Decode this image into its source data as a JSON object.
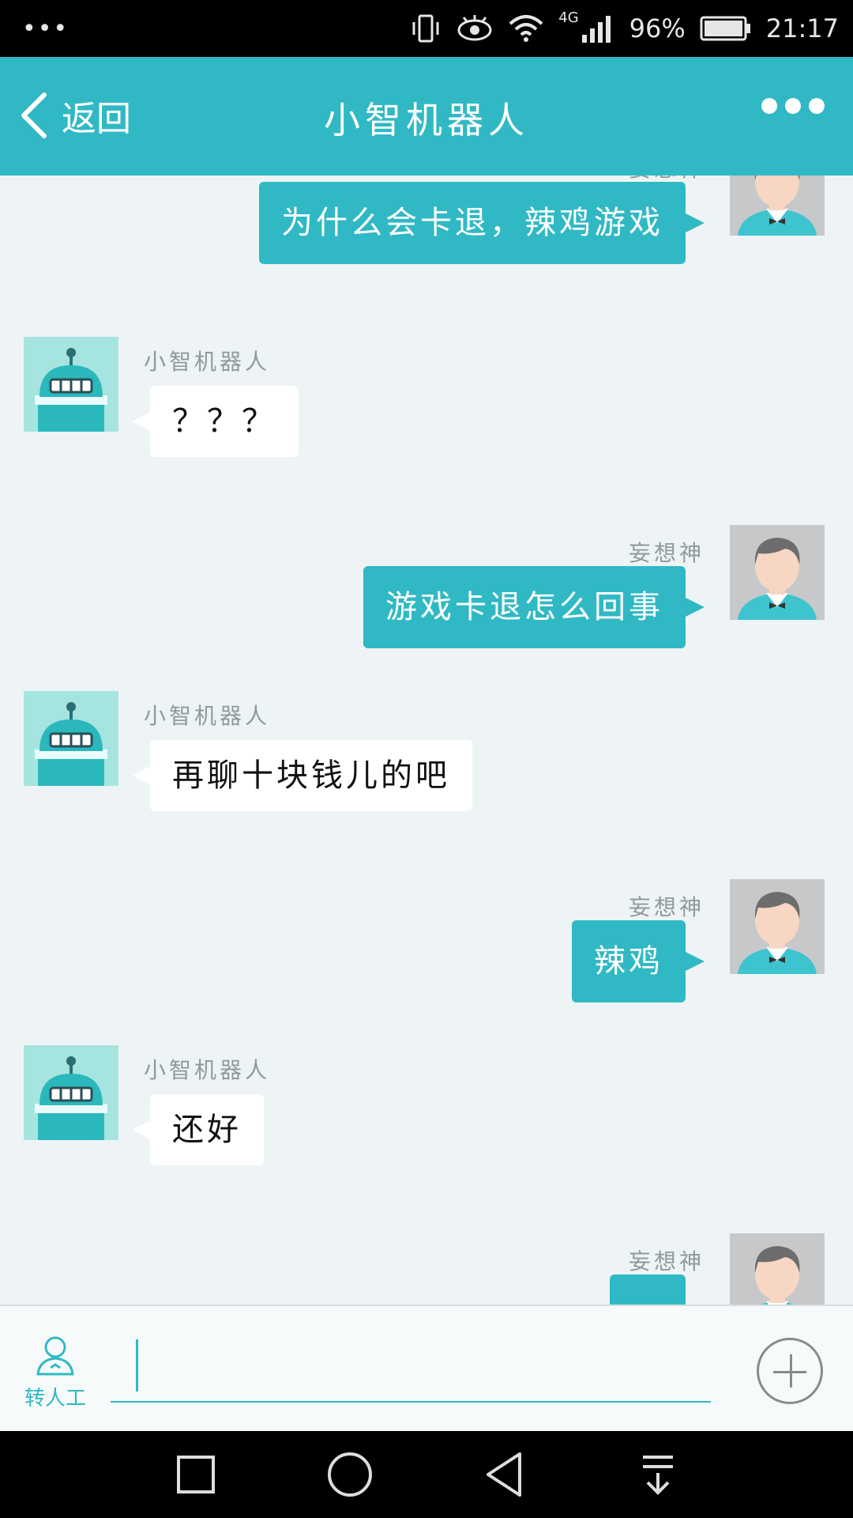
{
  "status_bar": {
    "notification_icon": "more-dots",
    "network": "4G",
    "battery": "96%",
    "time": "21:17"
  },
  "header": {
    "back_label": "返回",
    "title": "小智机器人",
    "more_icon": "more-icon"
  },
  "messages": [
    {
      "sender": "user",
      "name": "妄想神",
      "text": "为什么会卡退，辣鸡游戏"
    },
    {
      "sender": "bot",
      "name": "小智机器人",
      "text": "？？？"
    },
    {
      "sender": "user",
      "name": "妄想神",
      "text": "游戏卡退怎么回事"
    },
    {
      "sender": "bot",
      "name": "小智机器人",
      "text": "再聊十块钱儿的吧"
    },
    {
      "sender": "user",
      "name": "妄想神",
      "text": "辣鸡"
    },
    {
      "sender": "bot",
      "name": "小智机器人",
      "text": "还好"
    },
    {
      "sender": "user",
      "name": "妄想神",
      "text": ""
    }
  ],
  "input_bar": {
    "to_human_label": "转人工",
    "input_value": "",
    "plus_icon": "plus-circle-icon"
  },
  "colors": {
    "accent": "#30b9c4",
    "background": "#eef4f5"
  }
}
